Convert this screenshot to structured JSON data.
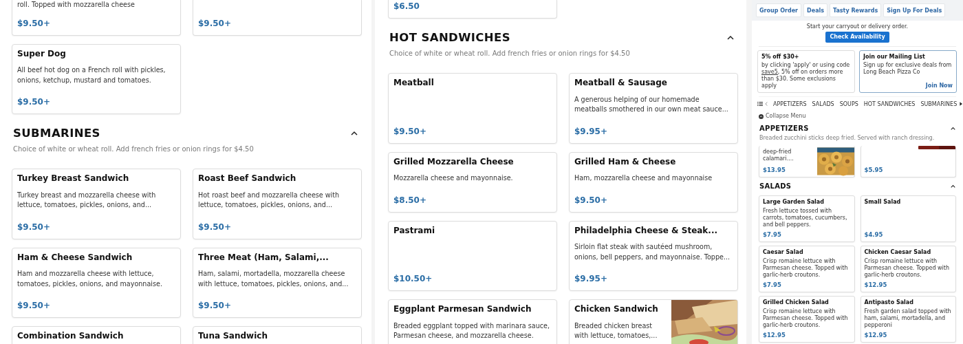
{
  "left_pane": {
    "sections": [
      {
        "items": [
          {
            "kind": "plain",
            "cut_top": true,
            "description": "roll. Topped with mozzarella cheese",
            "price": "$9.50+"
          },
          {
            "kind": "plain",
            "cut_top": true,
            "price": "$9.50+"
          },
          {
            "kind": "plain",
            "cut_top": false,
            "name": "Super Dog",
            "description": "All beef hot dog on a French roll with pickles, onions, ketchup, mustard and tomatoes.",
            "price": "$9.50+"
          }
        ]
      },
      {
        "title": "SUBMARINES",
        "expanded": true,
        "subtitle": "Choice of white or wheat roll. Add french fries or onion rings for $4.50",
        "items": [
          {
            "kind": "plain",
            "cut_top": false,
            "name": "Turkey Breast Sandwich",
            "description": "Turkey breast and mozzarella cheese with lettuce, tomatoes, pickles, onions, and...",
            "price": "$9.50+"
          },
          {
            "kind": "plain",
            "cut_top": false,
            "name": "Roast Beef Sandwich",
            "description": "Hot roast beef and mozzarella cheese with lettuce, tomatoes, pickles, onions, and...",
            "price": "$9.50+"
          },
          {
            "kind": "plain",
            "cut_top": false,
            "name": "Ham & Cheese Sandwich",
            "description": "Ham and mozzarella cheese with lettuce, tomatoes, pickles, onions, and mayonnaise.",
            "price": "$9.50+"
          },
          {
            "kind": "plain",
            "cut_top": false,
            "name": "Three Meat (Ham, Salami,...",
            "description": "Ham, salami, mortadella, mozzarella cheese with lettuce, tomatoes, pickles, onions, and...",
            "price": "$9.50+"
          },
          {
            "kind": "plain",
            "cut_top": false,
            "name": "Combination Sandwich"
          },
          {
            "kind": "plain",
            "cut_top": false,
            "name": "Tuna Sandwich"
          }
        ]
      }
    ]
  },
  "middle_pane": {
    "sections": [
      {
        "items": [
          {
            "kind": "plain",
            "cut_top": true,
            "price": "$6.50"
          }
        ]
      },
      {
        "title": "HOT SANDWICHES",
        "expanded": true,
        "subtitle": "Choice of white or wheat roll. Add french fries or onion rings for $4.50",
        "items": [
          {
            "kind": "plain",
            "cut_top": false,
            "name": "Meatball",
            "price": "$9.50+"
          },
          {
            "kind": "plain",
            "cut_top": false,
            "name": "Meatball & Sausage",
            "description": "A generous helping of our homemade meatballs smothered in our own meat sauce...",
            "price": "$9.95+"
          },
          {
            "kind": "plain",
            "cut_top": false,
            "name": "Grilled Mozzarella Cheese",
            "description": "Mozzarella cheese and mayonnaise.",
            "price": "$8.50+"
          },
          {
            "kind": "plain",
            "cut_top": false,
            "name": "Grilled Ham & Cheese",
            "description": "Ham, mozzarella cheese and mayonnaise",
            "price": "$9.50+"
          },
          {
            "kind": "plain",
            "cut_top": false,
            "name": "Pastrami",
            "price": "$10.50+"
          },
          {
            "kind": "plain",
            "cut_top": false,
            "name": "Philadelphia Cheese & Steak...",
            "description": "Sirloin flat steak with sautéed mushroom, onions, bell peppers, and mayonnaise. Toppe...",
            "price": "$9.95+"
          },
          {
            "kind": "plain",
            "cut_top": false,
            "name": "Eggplant Parmesan Sandwich",
            "description": "Breaded eggplant topped with marinara sauce, Parmesan cheese, and mozzarella cheese."
          },
          {
            "cut_top": false,
            "name": "Chicken Sandwich",
            "description": "Breaded chicken breast with lettuce, tomatoes,..."
          }
        ]
      }
    ]
  },
  "right_pane": {
    "nav_buttons": [
      "Group Order",
      "Deals",
      "Tasty Rewards",
      "Sign Up For Deals"
    ],
    "order_prompt": "Start your carryout or delivery order.",
    "check_button": "Check Availability",
    "promos": [
      {
        "highlighted": false,
        "title": "5% off $30+",
        "text_before": "by clicking 'apply' or using code ",
        "code": "save5",
        "text_after": ", 5% off on orders more than $30. Some exclusions apply"
      },
      {
        "highlighted": true,
        "title": "Join our Mailing List",
        "text": "Sign up for exclusive deals from Long Beach Pizza Co",
        "link": "Join Now"
      }
    ],
    "category_tabs": [
      "APPETIZERS",
      "SALADS",
      "SOUPS",
      "HOT SANDWICHES",
      "SUBMARINES"
    ],
    "collapse_menu": "Collapse Menu",
    "sections": [
      {
        "title": "APPETIZERS",
        "expanded": true,
        "subtitle": "Breaded zucchini sticks deep fried. Served with ranch dressing.",
        "items": [
          {
            "cut_top": true,
            "description": "deep-fried calamari....",
            "price": "$13.95"
          },
          {
            "kind": "photo-strip",
            "cut_top": true,
            "price": "$5.95"
          }
        ]
      },
      {
        "title": "SALADS",
        "expanded": true,
        "items": [
          {
            "kind": "plain",
            "cut_top": false,
            "name": "Large Garden Salad",
            "description": "Fresh lettuce tossed with carrots, tomatoes, cucumbers, and bell peppers.",
            "price": "$7.95"
          },
          {
            "kind": "plain",
            "cut_top": false,
            "name": "Small Salad",
            "price": "$4.95"
          },
          {
            "kind": "plain",
            "cut_top": false,
            "name": "Caesar Salad",
            "description": "Crisp romaine lettuce with Parmesan cheese. Topped with garlic-herb croutons.",
            "price": "$7.95"
          },
          {
            "kind": "plain",
            "cut_top": false,
            "name": "Chicken Caesar Salad",
            "description": "Crisp romaine lettuce with Parmesan cheese. Topped with garlic-herb croutons.",
            "price": "$12.95"
          },
          {
            "kind": "plain",
            "cut_top": false,
            "name": "Grilled Chicken Salad",
            "description": "Crisp romaine lettuce with Parmesan cheese. Topped with garlic-herb croutons.",
            "price": "$12.95"
          },
          {
            "kind": "plain",
            "cut_top": false,
            "name": "Antipasto Salad",
            "description": "Fresh garden salad topped with ham, salami, mortadella, and pepperoni",
            "price": "$12.95"
          }
        ]
      }
    ]
  }
}
